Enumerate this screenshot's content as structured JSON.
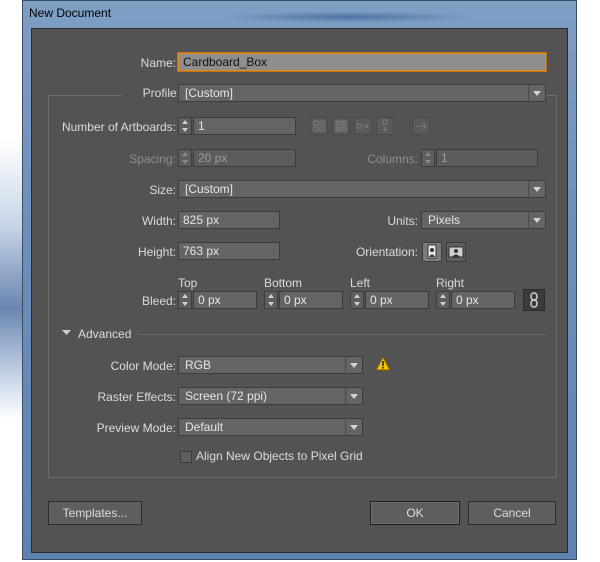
{
  "window": {
    "title": "New Document"
  },
  "name": {
    "label": "Name:",
    "value": "Cardboard_Box"
  },
  "profile": {
    "label": "Profile:",
    "value": "[Custom]"
  },
  "artboards": {
    "label": "Number of Artboards:",
    "value": "1"
  },
  "spacing": {
    "label": "Spacing:",
    "value": "20 px"
  },
  "columns": {
    "label": "Columns:",
    "value": "1"
  },
  "size": {
    "label": "Size:",
    "value": "[Custom]"
  },
  "width": {
    "label": "Width:",
    "value": "825 px"
  },
  "units": {
    "label": "Units:",
    "value": "Pixels"
  },
  "height": {
    "label": "Height:",
    "value": "763 px"
  },
  "orientation": {
    "label": "Orientation:"
  },
  "bleed": {
    "label": "Bleed:",
    "top_label": "Top",
    "top_value": "0 px",
    "bottom_label": "Bottom",
    "bottom_value": "0 px",
    "left_label": "Left",
    "left_value": "0 px",
    "right_label": "Right",
    "right_value": "0 px"
  },
  "advanced": {
    "label": "Advanced",
    "color_mode_label": "Color Mode:",
    "color_mode_value": "RGB",
    "raster_label": "Raster Effects:",
    "raster_value": "Screen (72 ppi)",
    "preview_label": "Preview Mode:",
    "preview_value": "Default",
    "align_label": "Align New Objects to Pixel Grid",
    "align_checked": false
  },
  "buttons": {
    "templates": "Templates...",
    "ok": "OK",
    "cancel": "Cancel"
  },
  "colors": {
    "dialog_bg": "#535353",
    "warning": "#f2c500",
    "focus": "#e08a1c"
  }
}
